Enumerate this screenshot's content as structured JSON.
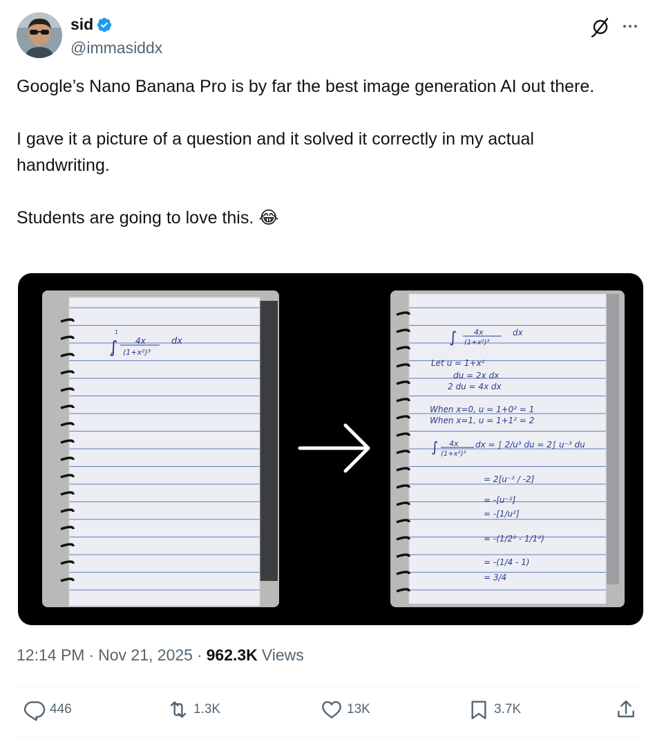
{
  "author": {
    "display_name": "sid",
    "handle": "@immasiddx"
  },
  "tweet": {
    "paragraphs": [
      "Google’s Nano Banana Pro is by far the best image generation AI out there.",
      "I gave it a picture of a question and it solved it correctly in my actual handwriting.",
      "Students are going to love this. 😂"
    ]
  },
  "media": {
    "left_notebook": {
      "problem": [
        "∫",
        "4x",
        "(1+x²)³",
        "dx",
        "1",
        "0"
      ]
    },
    "right_notebook": {
      "lines": [
        "Let   u = 1+x²",
        "du = 2x dx",
        "2 du = 4x dx",
        "When  x=0,  u = 1+0² = 1",
        "When  x=1,  u = 1+1² = 2",
        "= 2[u⁻² / -2]",
        "= -[u⁻²]",
        "= -[1/u²]",
        "= -(1/2² - 1/1²)",
        "= -(1/4 - 1)",
        "= 3/4"
      ],
      "step_integral": "dx = ∫ 2/u³ du = 2∫ u⁻³ du"
    }
  },
  "meta": {
    "time": "12:14 PM",
    "date": "Nov 21, 2025",
    "views_count": "962.3K",
    "views_label": "Views"
  },
  "actions": {
    "replies": "446",
    "reposts": "1.3K",
    "likes": "13K",
    "bookmarks": "3.7K"
  },
  "icons": {
    "verified": "verified-badge-icon",
    "grok": "grok-icon",
    "more": "more-icon",
    "reply": "reply-icon",
    "repost": "repost-icon",
    "like": "heart-icon",
    "bookmark": "bookmark-icon",
    "share": "share-icon"
  },
  "colors": {
    "text": "#0f1419",
    "secondary": "#536471",
    "verified": "#1d9bf0",
    "media_bg": "#000000",
    "ink": "#2b3a8c"
  }
}
